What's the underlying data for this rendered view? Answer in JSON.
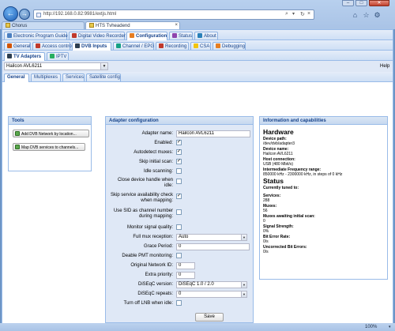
{
  "browser": {
    "address": "http://192.168.0.82:9981/extjs.html",
    "tabs": [
      {
        "label": "Chorus"
      },
      {
        "label": "HTS Tvheadend"
      }
    ],
    "window_buttons": {
      "minimize": "–",
      "maximize": "□",
      "close": "✕"
    },
    "nav": {
      "back": "←",
      "forward": "→"
    },
    "toolbar_icons": {
      "home": "⌂",
      "favorites": "☆",
      "settings": "⚙"
    },
    "zoom": "100%"
  },
  "app": {
    "main_tabs": [
      {
        "label": "Electronic Program Guide",
        "icon": "epg-icon",
        "color": "#4a7fc1"
      },
      {
        "label": "Digital Video Recorder",
        "icon": "dvr-icon",
        "color": "#c0392b"
      },
      {
        "label": "Configuration",
        "icon": "config-icon",
        "color": "#e67e22"
      },
      {
        "label": "Status",
        "icon": "status-icon",
        "color": "#8e44ad"
      },
      {
        "label": "About",
        "icon": "about-icon",
        "color": "#2980b9"
      }
    ],
    "config_tabs": [
      {
        "label": "General",
        "icon": "general-icon",
        "color": "#d35400"
      },
      {
        "label": "Access control",
        "icon": "access-icon",
        "color": "#c0392b"
      },
      {
        "label": "DVB Inputs",
        "icon": "dvb-icon",
        "color": "#2c3e50"
      },
      {
        "label": "Channel / EPG",
        "icon": "channel-icon",
        "color": "#16a085"
      },
      {
        "label": "Recording",
        "icon": "recording-icon",
        "color": "#c0392b"
      },
      {
        "label": "CSA",
        "icon": "csa-icon",
        "color": "#f1c40f"
      },
      {
        "label": "Debugging",
        "icon": "debug-icon",
        "color": "#e67e22"
      }
    ],
    "dvb_tabs": [
      {
        "label": "TV Adapters",
        "icon": "tv-icon",
        "color": "#2c3e50"
      },
      {
        "label": "IPTV",
        "icon": "iptv-icon",
        "color": "#27ae60"
      }
    ],
    "adapter_selected": "Hailcon AVL6211",
    "help": "Help",
    "adapter_tabs": [
      {
        "label": "General"
      },
      {
        "label": "Multiplexes"
      },
      {
        "label": "Services"
      },
      {
        "label": "Satellite config"
      }
    ],
    "tools": {
      "title": "Tools",
      "add_label": "Add DVB Network by location...",
      "map_label": "Map DVB services to channels..."
    },
    "config": {
      "title": "Adapter configuration",
      "adapter_name_label": "Adapter name:",
      "adapter_name_value": "Hailcon AVL6211",
      "enabled_label": "Enabled:",
      "autodetect_label": "Autodetect muxes:",
      "skip_initial_label": "Skip initial scan:",
      "idle_label": "Idle scanning:",
      "close_handle_label": "Close device handle when idle:",
      "skip_service_label": "Skip service availability check when mapping:",
      "use_sid_label": "Use SID as channel number during mapping:",
      "monitor_label": "Monitor signal quality:",
      "full_mux_label": "Full mux reception:",
      "full_mux_value": "Auto",
      "grace_label": "Grace Period:",
      "grace_value": "0",
      "pmt_label": "Deable PMT monitoring:",
      "onid_label": "Original Network ID:",
      "onid_value": "0",
      "extra_label": "Extra priority:",
      "extra_value": "0",
      "diseqc_version_label": "DiSEqC version:",
      "diseqc_version_value": "DiSEqC 1.0 / 2.0",
      "diseqc_repeats_label": "DiSEqC repeats:",
      "diseqc_repeats_value": "0",
      "lnb_label": "Turn off LNB when idle:",
      "save_label": "Save",
      "checked": "✓"
    },
    "info": {
      "title": "Information and capabilities",
      "hardware_heading": "Hardware",
      "device_path_k": "Device path:",
      "device_path_v": "/dev/dvb/adapter3",
      "device_name_k": "Device name:",
      "device_name_v": "Hailcon AVL6211",
      "host_conn_k": "Host connection:",
      "host_conn_v": "USB (480 Mbit/s)",
      "if_range_k": "Intermediate Frequency range:",
      "if_range_v": "850000 kHz - 2300000 kHz, in steps of 0 kHz",
      "status_heading": "Status",
      "tuned_k": "Currently tuned to:",
      "services_k": "Services:",
      "services_v": "288",
      "muxes_k": "Muxes:",
      "muxes_v": "56",
      "muxes_await_k": "Muxes awaiting initial scan:",
      "muxes_await_v": "0",
      "signal_k": "Signal Strength:",
      "signal_v": "0%",
      "ber_k": "Bit Error Rate:",
      "ber_v": "0/s",
      "unc_k": "Uncorrected Bit Errors:",
      "unc_v": "0/s"
    }
  }
}
